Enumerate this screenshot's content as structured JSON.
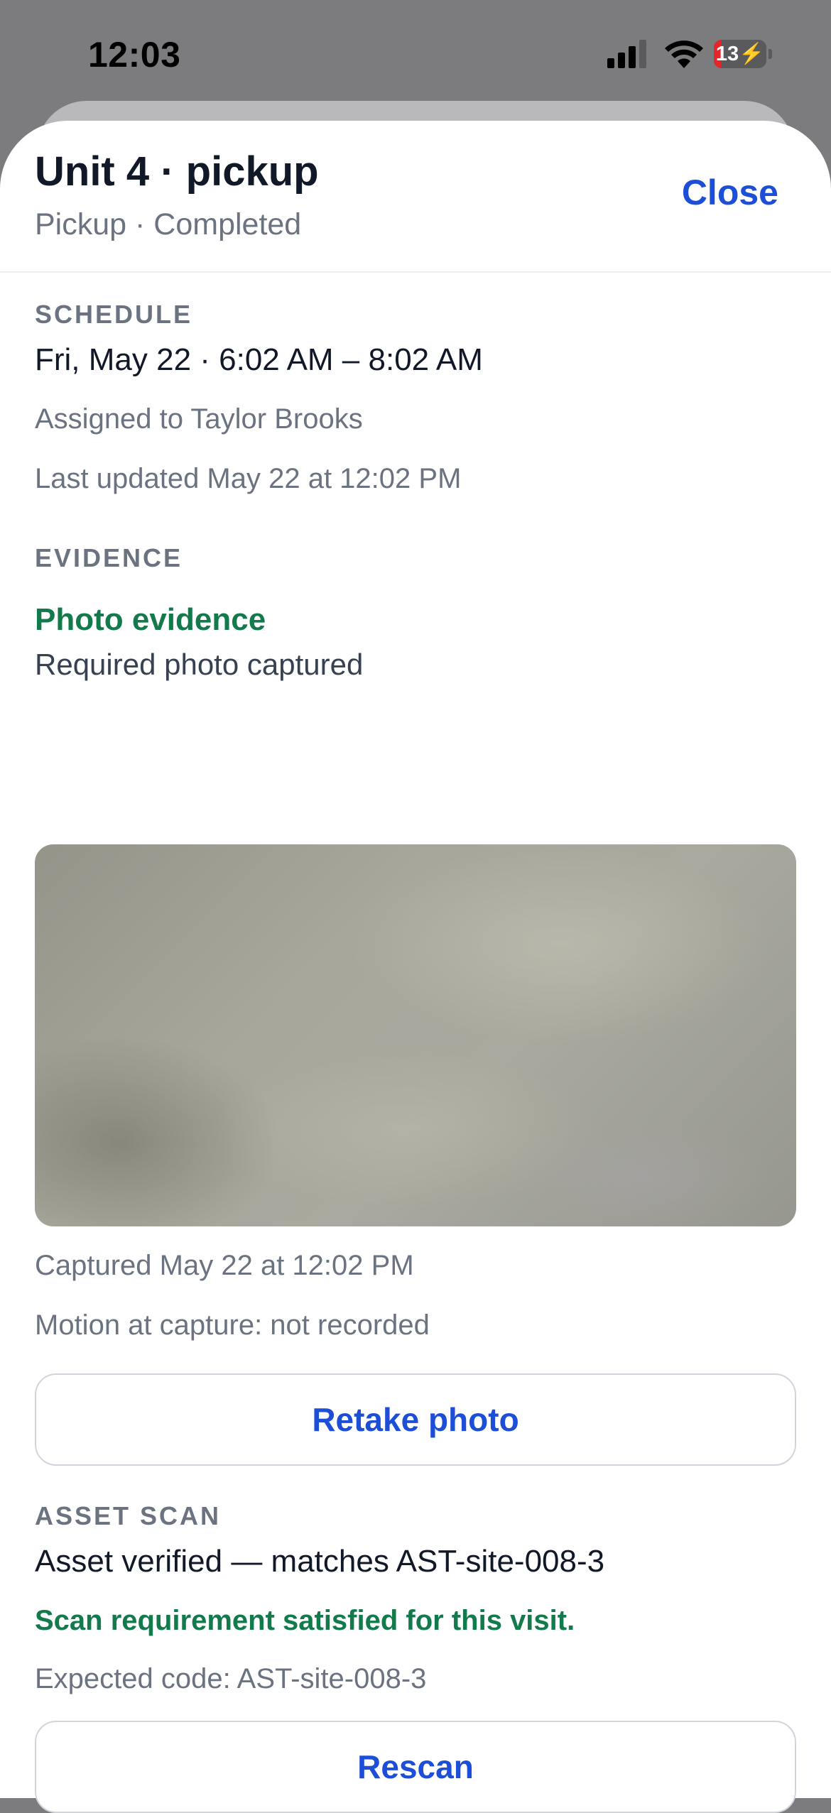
{
  "status_bar": {
    "time": "12:03",
    "battery_level": "13",
    "battery_percent": 13,
    "signal_icon": "cellular-signal-icon",
    "wifi_icon": "wifi-icon",
    "charging": true
  },
  "header": {
    "title": "Unit 4 · pickup",
    "subtitle": "Pickup · Completed",
    "close_label": "Close"
  },
  "schedule": {
    "label": "SCHEDULE",
    "time_range": "Fri, May 22 · 6:02 AM – 8:02 AM",
    "assignee": "Assigned to Taylor Brooks",
    "last_updated": "Last updated May 22 at 12:02 PM"
  },
  "evidence": {
    "label": "EVIDENCE",
    "title": "Photo evidence",
    "status": "Required photo captured",
    "captured": "Captured May 22 at 12:02 PM",
    "motion": "Motion at capture: not recorded",
    "retake_label": "Retake photo"
  },
  "asset_scan": {
    "label": "ASSET SCAN",
    "result": "Asset verified — matches AST-site-008-3",
    "requirement": "Scan requirement satisfied for this visit.",
    "expected": "Expected code: AST-site-008-3",
    "rescan_label": "Rescan"
  },
  "colors": {
    "accent": "#1d4ed8",
    "success": "#137a4b",
    "battery_low": "#e5252a"
  }
}
